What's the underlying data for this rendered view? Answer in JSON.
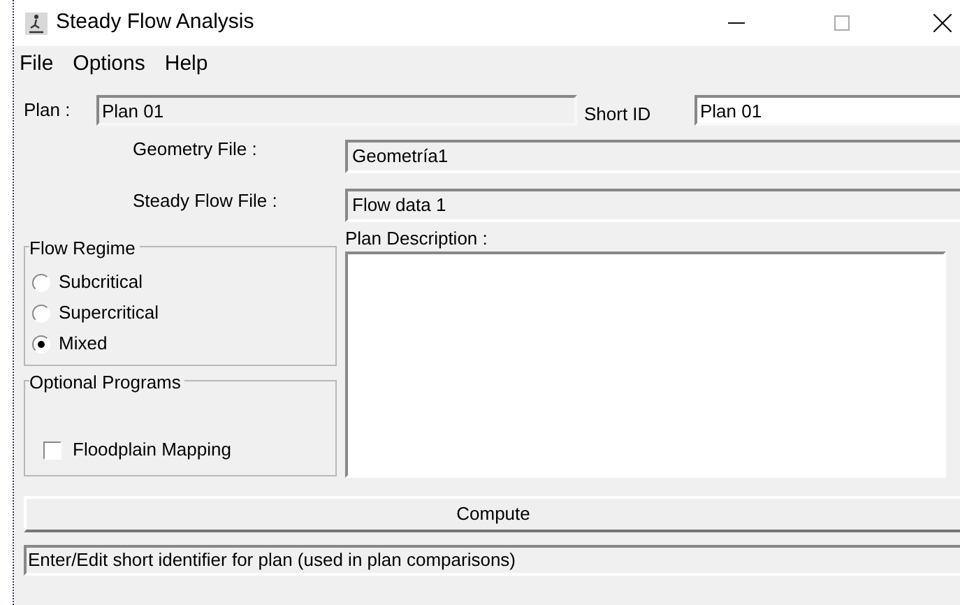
{
  "window": {
    "title": "Steady Flow Analysis"
  },
  "menu": [
    "File",
    "Options",
    "Help"
  ],
  "plan": {
    "label": "Plan :",
    "value": "Plan 01"
  },
  "short_id": {
    "label": "Short ID",
    "value": "Plan 01"
  },
  "geometry_file": {
    "label": "Geometry File :",
    "value": "Geometría1"
  },
  "steady_flow_file": {
    "label": "Steady Flow File :",
    "value": "Flow data 1"
  },
  "plan_description": {
    "label": "Plan Description :"
  },
  "flow_regime": {
    "title": "Flow Regime",
    "options": [
      {
        "label": "Subcritical",
        "selected": false
      },
      {
        "label": "Supercritical",
        "selected": false
      },
      {
        "label": "Mixed",
        "selected": true
      }
    ]
  },
  "optional_programs": {
    "title": "Optional Programs",
    "options": [
      {
        "label": "Floodplain Mapping",
        "checked": false
      }
    ]
  },
  "compute_button": "Compute",
  "status_bar": "Enter/Edit short identifier for plan (used in plan comparisons)"
}
